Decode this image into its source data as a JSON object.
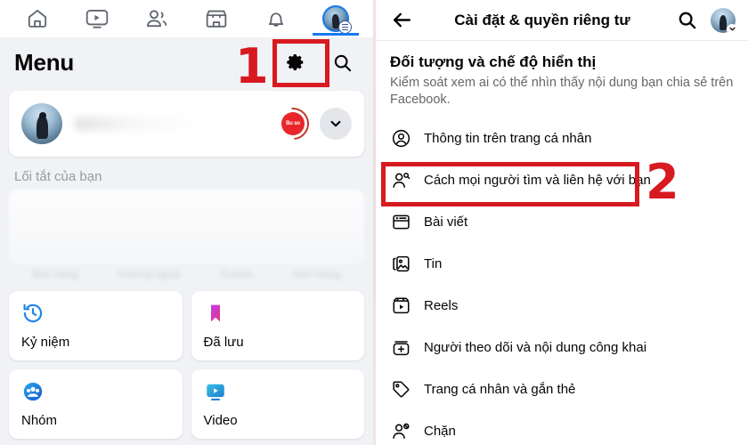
{
  "left_panel": {
    "topnav": [
      {
        "name": "home-icon",
        "label": "Trang chủ"
      },
      {
        "name": "video-icon",
        "label": "Video"
      },
      {
        "name": "friends-icon",
        "label": "Bạn bè"
      },
      {
        "name": "marketplace-icon",
        "label": "Marketplace"
      },
      {
        "name": "notifications-bell-icon",
        "label": "Thông báo"
      },
      {
        "name": "profile-avatar-menu",
        "label": "Menu"
      }
    ],
    "header": {
      "title": "Menu",
      "settings_icon": "gear-icon",
      "search_icon": "search-icon"
    },
    "profile_card": {
      "name": "",
      "switch_badge_text": "Bu so",
      "chevron_icon": "chevron-down-icon"
    },
    "shortcuts_label": "Lối tắt của bạn",
    "blurred_labels": [
      "Bán hàng",
      "Hướng ngoại",
      "Events",
      "Anh Hùng"
    ],
    "shortcut_cards": [
      {
        "label": "Kỷ niệm",
        "icon": "memories-clock-icon",
        "color": "#1f86e8"
      },
      {
        "label": "Đã lưu",
        "icon": "saved-bookmark-icon",
        "color": "#a334d6"
      },
      {
        "label": "Nhóm",
        "icon": "groups-icon",
        "color": "#1f86e8"
      },
      {
        "label": "Video",
        "icon": "video-play-icon",
        "color": "#2aa7d8"
      }
    ],
    "annotation": {
      "number": "1"
    }
  },
  "right_panel": {
    "header": {
      "back_icon": "back-arrow-icon",
      "title": "Cài đặt & quyền riêng tư",
      "search_icon": "search-icon",
      "avatar": "profile-avatar"
    },
    "section": {
      "heading": "Đối tượng và chế độ hiển thị",
      "description": "Kiểm soát xem ai có thể nhìn thấy nội dung bạn chia sẻ trên Facebook."
    },
    "items": [
      {
        "label": "Thông tin trên trang cá nhân",
        "icon": "user-circle-icon",
        "highlighted": false
      },
      {
        "label": "Cách mọi người tìm và liên hệ với bạn",
        "icon": "person-search-icon",
        "highlighted": true
      },
      {
        "label": "Bài viết",
        "icon": "post-article-icon",
        "highlighted": false
      },
      {
        "label": "Tin",
        "icon": "stories-photos-icon",
        "highlighted": false
      },
      {
        "label": "Reels",
        "icon": "reels-icon",
        "highlighted": false
      },
      {
        "label": "Người theo dõi và nội dung công khai",
        "icon": "followers-add-icon",
        "highlighted": false
      },
      {
        "label": "Trang cá nhân và gắn thẻ",
        "icon": "tag-icon",
        "highlighted": false
      },
      {
        "label": "Chặn",
        "icon": "block-person-icon",
        "highlighted": false
      }
    ],
    "annotation": {
      "number": "2"
    }
  },
  "colors": {
    "annotation_red": "#d71920",
    "facebook_blue": "#1877f2",
    "panel_bg": "#f0f2f5",
    "text_primary": "#050505",
    "text_secondary": "#65676b"
  }
}
